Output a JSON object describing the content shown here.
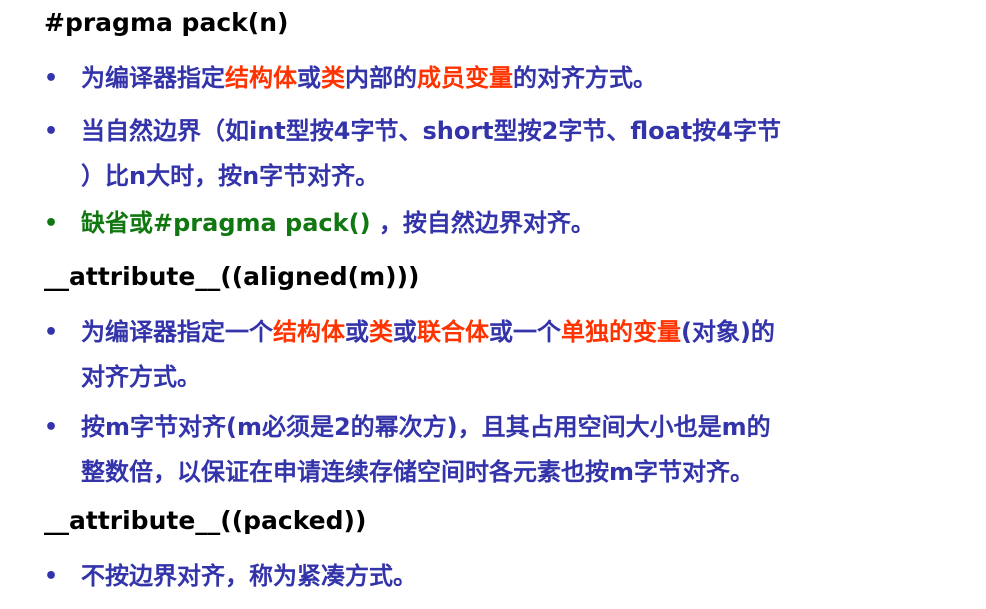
{
  "colors": {
    "blue": "#3333aa",
    "red": "#ff3300",
    "green": "#117711",
    "black": "#000000"
  },
  "headings": [
    "#pragma pack(n)",
    "__attribute__((aligned(m)))",
    "__attribute__((packed))"
  ],
  "bullets": [
    {
      "segments": [
        {
          "text": "为编译器指定",
          "color": "blue"
        },
        {
          "text": "结构体",
          "color": "red"
        },
        {
          "text": "或",
          "color": "blue"
        },
        {
          "text": "类",
          "color": "red"
        },
        {
          "text": "内部的",
          "color": "blue"
        },
        {
          "text": "成员变量",
          "color": "red"
        },
        {
          "text": "的对齐方式。",
          "color": "blue"
        }
      ]
    },
    {
      "segments": [
        {
          "text": "当自然边界（如int型按4字节、short型按2字节、float按4字节\n）比n大时，按n字节对齐。",
          "color": "blue"
        }
      ]
    },
    {
      "segments": [
        {
          "text": "缺省或#pragma pack()",
          "color": "green"
        },
        {
          "text": " ，按自然边界对齐。",
          "color": "blue"
        }
      ]
    },
    {
      "segments": [
        {
          "text": "为编译器指定一个",
          "color": "blue"
        },
        {
          "text": "结构体",
          "color": "red"
        },
        {
          "text": "或",
          "color": "blue"
        },
        {
          "text": "类",
          "color": "red"
        },
        {
          "text": "或",
          "color": "blue"
        },
        {
          "text": "联合体",
          "color": "red"
        },
        {
          "text": "或一个",
          "color": "blue"
        },
        {
          "text": "单独的变量",
          "color": "red"
        },
        {
          "text": "(对象)的\n对齐方式。",
          "color": "blue"
        }
      ]
    },
    {
      "segments": [
        {
          "text": "按m字节对齐(m必须是2的幂次方)，且其占用空间大小也是m的\n整数倍，以保证在申请连续存储空间时各元素也按m字节对齐。",
          "color": "blue"
        }
      ]
    },
    {
      "segments": [
        {
          "text": "不按边界对齐，称为紧凑方式。",
          "color": "blue"
        }
      ]
    }
  ]
}
